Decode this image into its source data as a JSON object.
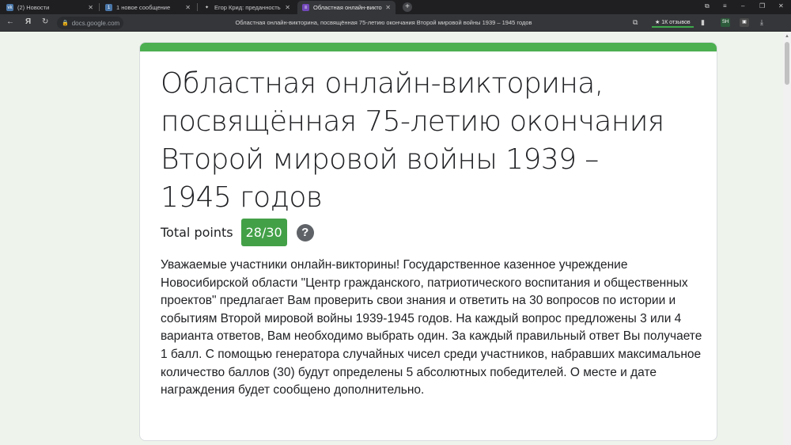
{
  "browser": {
    "tabs": [
      {
        "title": "(2) Новости",
        "icon": "vk-icon",
        "color": "#4a76a8",
        "glyph": "vk"
      },
      {
        "title": "1 новое сообщение",
        "icon": "vk-message-icon",
        "color": "#4a76a8",
        "glyph": "1"
      },
      {
        "title": "Егор Крид: преданность од",
        "icon": "star-icon",
        "color": "#35363a",
        "glyph": "✦"
      },
      {
        "title": "Областная онлайн-викторин",
        "icon": "google-forms-icon",
        "color": "#7248b9",
        "glyph": "≡"
      }
    ],
    "url": "docs.google.com",
    "page_title": "Областная онлайн-викторина, посвящённая 75-летию окончания Второй мировой войны 1939 – 1945 годов",
    "reviews_label": "★ 1К отзывов",
    "yandex_glyph": "Я"
  },
  "form": {
    "accent_color": "#4caf50",
    "title": "Областная онлайн-викторина, посвящённая 75-летию окончания Второй мировой войны 1939 – 1945 годов",
    "total_points_label": "Total points",
    "score": "28/30",
    "help_glyph": "?",
    "description": "Уважаемые участники онлайн-викторины! Государственное казенное учреждение Новосибирской области \"Центр гражданского, патриотического воспитания и общественных проектов\" предлагает Вам проверить свои знания и ответить на 30 вопросов по истории и событиям Второй мировой войны 1939-1945 годов. На каждый вопрос предложены 3 или 4 варианта ответов, Вам необходимо выбрать один. За каждый правильный ответ Вы получаете 1 балл. С помощью генератора случайных чисел среди участников, набравших максимальное количество баллов (30) будут определены 5 абсолютных победителей. О месте и дате награждения будет сообщено дополнительно."
  }
}
